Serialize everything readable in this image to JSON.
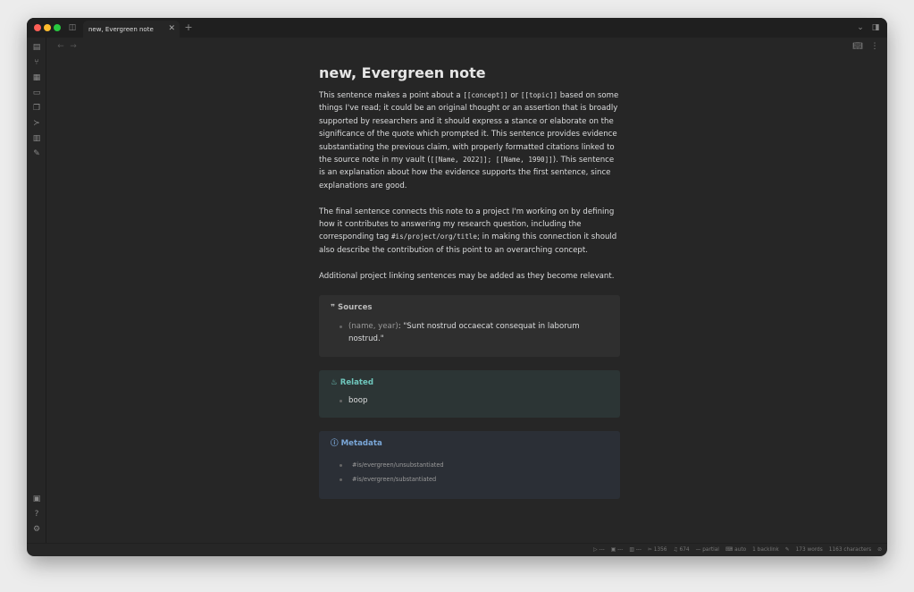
{
  "tab": {
    "title": "new, Evergreen note"
  },
  "note": {
    "title": "new, Evergreen note",
    "p1": [
      "This sentence makes a point about a ",
      "[[concept]]",
      " or ",
      "[[topic]]",
      " based on some things I've read; it could be an original thought or an assertion that is broadly supported by researchers and it should express a stance or elaborate on the significance of the quote which prompted it. This sentence provides evidence substantiating the previous claim, with properly formatted citations linked to the source note in my vault (",
      "[[Name, 2022]]; [[Name, 1990]]",
      "). This sentence is an explanation about how the evidence supports the first sentence, since explanations are good."
    ],
    "p2": [
      "The final sentence connects this note to a project I'm working on by defining how it contributes to answering my research question, including the corresponding tag ",
      "#is/project/org/title",
      "; in making this connection it should also describe the contribution of this point to an overarching concept."
    ],
    "p3": "Additional project linking sentences may be added as they become relevant.",
    "sources": {
      "title": "Sources",
      "cite": "(name, year)",
      "quote": ": \"Sunt nostrud occaecat consequat in laborum nostrud.\"",
      "color": "#2f2f2f"
    },
    "related": {
      "title": "Related",
      "items": [
        "boop"
      ],
      "color": "#2c3535",
      "accent": "#6fc7bd"
    },
    "metadata": {
      "title": "Metadata",
      "items": [
        "#is/evergreen/unsubstantiated",
        "#is/evergreen/substantiated"
      ],
      "color": "#2b2f36",
      "accent": "#7aa7d8"
    }
  },
  "status": {
    "items": [
      "---",
      "---",
      "---",
      "1356",
      "674",
      "partial",
      "auto",
      "1 backlink",
      "173 words",
      "1163 characters"
    ]
  }
}
